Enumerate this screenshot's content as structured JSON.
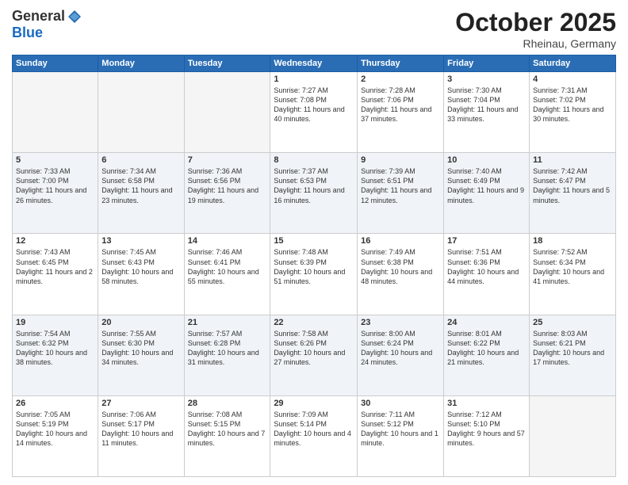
{
  "logo": {
    "general": "General",
    "blue": "Blue"
  },
  "header": {
    "month": "October 2025",
    "location": "Rheinau, Germany"
  },
  "weekdays": [
    "Sunday",
    "Monday",
    "Tuesday",
    "Wednesday",
    "Thursday",
    "Friday",
    "Saturday"
  ],
  "weeks": [
    [
      {
        "day": "",
        "info": ""
      },
      {
        "day": "",
        "info": ""
      },
      {
        "day": "",
        "info": ""
      },
      {
        "day": "1",
        "info": "Sunrise: 7:27 AM\nSunset: 7:08 PM\nDaylight: 11 hours and 40 minutes."
      },
      {
        "day": "2",
        "info": "Sunrise: 7:28 AM\nSunset: 7:06 PM\nDaylight: 11 hours and 37 minutes."
      },
      {
        "day": "3",
        "info": "Sunrise: 7:30 AM\nSunset: 7:04 PM\nDaylight: 11 hours and 33 minutes."
      },
      {
        "day": "4",
        "info": "Sunrise: 7:31 AM\nSunset: 7:02 PM\nDaylight: 11 hours and 30 minutes."
      }
    ],
    [
      {
        "day": "5",
        "info": "Sunrise: 7:33 AM\nSunset: 7:00 PM\nDaylight: 11 hours and 26 minutes."
      },
      {
        "day": "6",
        "info": "Sunrise: 7:34 AM\nSunset: 6:58 PM\nDaylight: 11 hours and 23 minutes."
      },
      {
        "day": "7",
        "info": "Sunrise: 7:36 AM\nSunset: 6:56 PM\nDaylight: 11 hours and 19 minutes."
      },
      {
        "day": "8",
        "info": "Sunrise: 7:37 AM\nSunset: 6:53 PM\nDaylight: 11 hours and 16 minutes."
      },
      {
        "day": "9",
        "info": "Sunrise: 7:39 AM\nSunset: 6:51 PM\nDaylight: 11 hours and 12 minutes."
      },
      {
        "day": "10",
        "info": "Sunrise: 7:40 AM\nSunset: 6:49 PM\nDaylight: 11 hours and 9 minutes."
      },
      {
        "day": "11",
        "info": "Sunrise: 7:42 AM\nSunset: 6:47 PM\nDaylight: 11 hours and 5 minutes."
      }
    ],
    [
      {
        "day": "12",
        "info": "Sunrise: 7:43 AM\nSunset: 6:45 PM\nDaylight: 11 hours and 2 minutes."
      },
      {
        "day": "13",
        "info": "Sunrise: 7:45 AM\nSunset: 6:43 PM\nDaylight: 10 hours and 58 minutes."
      },
      {
        "day": "14",
        "info": "Sunrise: 7:46 AM\nSunset: 6:41 PM\nDaylight: 10 hours and 55 minutes."
      },
      {
        "day": "15",
        "info": "Sunrise: 7:48 AM\nSunset: 6:39 PM\nDaylight: 10 hours and 51 minutes."
      },
      {
        "day": "16",
        "info": "Sunrise: 7:49 AM\nSunset: 6:38 PM\nDaylight: 10 hours and 48 minutes."
      },
      {
        "day": "17",
        "info": "Sunrise: 7:51 AM\nSunset: 6:36 PM\nDaylight: 10 hours and 44 minutes."
      },
      {
        "day": "18",
        "info": "Sunrise: 7:52 AM\nSunset: 6:34 PM\nDaylight: 10 hours and 41 minutes."
      }
    ],
    [
      {
        "day": "19",
        "info": "Sunrise: 7:54 AM\nSunset: 6:32 PM\nDaylight: 10 hours and 38 minutes."
      },
      {
        "day": "20",
        "info": "Sunrise: 7:55 AM\nSunset: 6:30 PM\nDaylight: 10 hours and 34 minutes."
      },
      {
        "day": "21",
        "info": "Sunrise: 7:57 AM\nSunset: 6:28 PM\nDaylight: 10 hours and 31 minutes."
      },
      {
        "day": "22",
        "info": "Sunrise: 7:58 AM\nSunset: 6:26 PM\nDaylight: 10 hours and 27 minutes."
      },
      {
        "day": "23",
        "info": "Sunrise: 8:00 AM\nSunset: 6:24 PM\nDaylight: 10 hours and 24 minutes."
      },
      {
        "day": "24",
        "info": "Sunrise: 8:01 AM\nSunset: 6:22 PM\nDaylight: 10 hours and 21 minutes."
      },
      {
        "day": "25",
        "info": "Sunrise: 8:03 AM\nSunset: 6:21 PM\nDaylight: 10 hours and 17 minutes."
      }
    ],
    [
      {
        "day": "26",
        "info": "Sunrise: 7:05 AM\nSunset: 5:19 PM\nDaylight: 10 hours and 14 minutes."
      },
      {
        "day": "27",
        "info": "Sunrise: 7:06 AM\nSunset: 5:17 PM\nDaylight: 10 hours and 11 minutes."
      },
      {
        "day": "28",
        "info": "Sunrise: 7:08 AM\nSunset: 5:15 PM\nDaylight: 10 hours and 7 minutes."
      },
      {
        "day": "29",
        "info": "Sunrise: 7:09 AM\nSunset: 5:14 PM\nDaylight: 10 hours and 4 minutes."
      },
      {
        "day": "30",
        "info": "Sunrise: 7:11 AM\nSunset: 5:12 PM\nDaylight: 10 hours and 1 minute."
      },
      {
        "day": "31",
        "info": "Sunrise: 7:12 AM\nSunset: 5:10 PM\nDaylight: 9 hours and 57 minutes."
      },
      {
        "day": "",
        "info": ""
      }
    ]
  ]
}
